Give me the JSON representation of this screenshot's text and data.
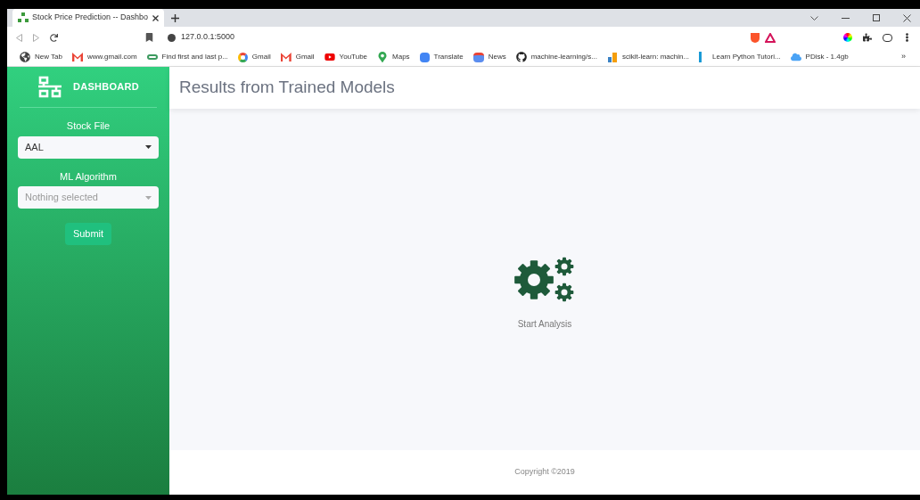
{
  "browser": {
    "tab_title": "Stock Price Prediction -- Dashbo",
    "url": "127.0.0.1:5000",
    "bookmarks": [
      {
        "kind": "globe",
        "label": "New Tab"
      },
      {
        "kind": "gmail",
        "label": "www.gmail.com"
      },
      {
        "kind": "link",
        "label": "Find first and last p..."
      },
      {
        "kind": "google",
        "label": "Gmail"
      },
      {
        "kind": "gmail",
        "label": "Gmail"
      },
      {
        "kind": "youtube",
        "label": "YouTube"
      },
      {
        "kind": "maps",
        "label": "Maps"
      },
      {
        "kind": "translate",
        "label": "Translate"
      },
      {
        "kind": "news",
        "label": "News"
      },
      {
        "kind": "github",
        "label": "machine-learning/s..."
      },
      {
        "kind": "chart",
        "label": "scikit-learn: machin..."
      },
      {
        "kind": "k",
        "label": "Learn Python Tutori..."
      },
      {
        "kind": "cloud",
        "label": "PDisk - 1.4gb"
      }
    ],
    "more": "»"
  },
  "sidebar": {
    "brand": "DASHBOARD",
    "fields": [
      {
        "label": "Stock File",
        "value": "AAL"
      },
      {
        "label": "ML Algorithm",
        "placeholder": "Nothing selected"
      }
    ],
    "submit": "Submit"
  },
  "header": {
    "title": "Results from Trained Models"
  },
  "content": {
    "caption": "Start Analysis"
  },
  "footer": {
    "text": "Copyright ©2019"
  }
}
